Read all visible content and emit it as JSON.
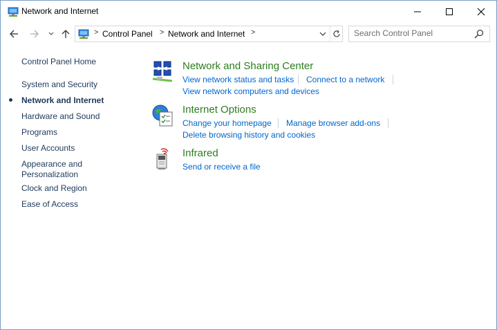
{
  "window": {
    "title": "Network and Internet"
  },
  "address": {
    "crumbs": [
      "Control Panel",
      "Network and Internet"
    ],
    "search_placeholder": "Search Control Panel"
  },
  "sidebar": {
    "home": "Control Panel Home",
    "items": [
      {
        "label": "System and Security"
      },
      {
        "label": "Network and Internet",
        "active": true
      },
      {
        "label": "Hardware and Sound"
      },
      {
        "label": "Programs"
      },
      {
        "label": "User Accounts"
      },
      {
        "label": "Appearance and"
      },
      {
        "label": "Personalization"
      },
      {
        "label": "Clock and Region"
      },
      {
        "label": "Ease of Access"
      }
    ]
  },
  "categories": [
    {
      "title": "Network and Sharing Center",
      "links": [
        "View network status and tasks",
        "Connect to a network",
        "View network computers and devices"
      ],
      "icon": "network-sharing-icon"
    },
    {
      "title": "Internet Options",
      "links": [
        "Change your homepage",
        "Manage browser add-ons",
        "Delete browsing history and cookies"
      ],
      "icon": "internet-options-icon"
    },
    {
      "title": "Infrared",
      "links": [
        "Send or receive a file"
      ],
      "icon": "infrared-icon"
    }
  ],
  "colors": {
    "category_title": "#2d7d1f",
    "link": "#0066cc",
    "nav_text": "#1e395b"
  }
}
